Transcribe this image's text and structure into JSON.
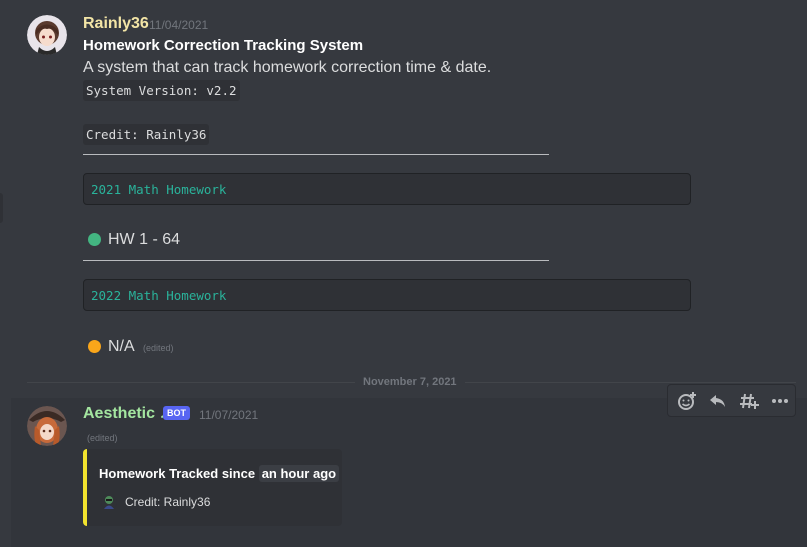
{
  "message1": {
    "username": "Rainly36",
    "timestamp": "11/04/2021",
    "title": "Homework Correction Tracking System",
    "description": "A system that can track homework correction time & date.",
    "version_code": "System Version: v2.2",
    "credit_code": "Credit: Rainly36",
    "divider": "———————————————————————————————————————",
    "block1": "2021 Math Homework",
    "status1": {
      "text": "HW 1 - 64",
      "color": "#43b581"
    },
    "block2": "2022 Math Homework",
    "status2": {
      "text": "N/A",
      "color": "#faa61a"
    },
    "edited": "(edited)"
  },
  "date_separator": "November 7, 2021",
  "message2": {
    "username": "Aesthetic ♪",
    "badge": "BOT",
    "timestamp": "11/07/2021",
    "edited": "(edited)",
    "embed": {
      "title_prefix": "Homework Tracked since",
      "title_highlight": "an hour ago",
      "footer": "Credit: Rainly36",
      "color": "#f2e32e"
    }
  },
  "toolbar": {
    "icons": [
      "add-reaction-icon",
      "reply-icon",
      "create-thread-icon",
      "more-options-icon"
    ]
  },
  "colors": {
    "username1": "#f3e5a6",
    "username2": "#a4e6a0",
    "code": "#2ab39b",
    "background": "#36393f"
  }
}
